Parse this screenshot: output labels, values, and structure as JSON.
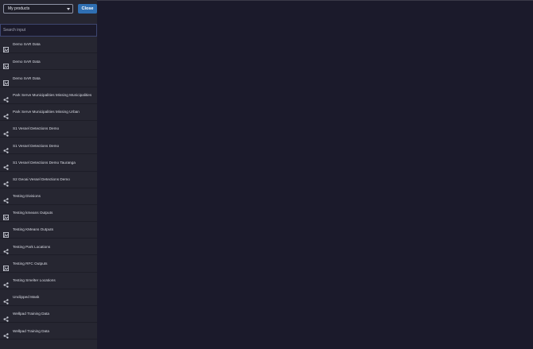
{
  "header": {
    "dropdown_value": "My products",
    "close_label": "Close"
  },
  "search": {
    "placeholder": "Search input"
  },
  "products": [
    {
      "label": "Demo SAR Data",
      "icon": "image-icon"
    },
    {
      "label": "Demo SAR Data",
      "icon": "image-icon"
    },
    {
      "label": "Demo SAR Data",
      "icon": "image-icon"
    },
    {
      "label": "Park Serve Municipalities Missing Municipalities",
      "icon": "share-icon"
    },
    {
      "label": "Park Serve Municipalities Missing Urban",
      "icon": "share-icon"
    },
    {
      "label": "S1 Vessel Detections Demo",
      "icon": "share-icon"
    },
    {
      "label": "S1 Vessel Detections Demo",
      "icon": "share-icon"
    },
    {
      "label": "S1 Vessel Detections Demo Tauranga",
      "icon": "share-icon"
    },
    {
      "label": "S2 Geoai Vessel Detections Demo",
      "icon": "share-icon"
    },
    {
      "label": "Testing Divisions",
      "icon": "share-icon"
    },
    {
      "label": "Testing kmeans Outputs",
      "icon": "image-icon"
    },
    {
      "label": "Testing KMeans Outputs",
      "icon": "image-icon"
    },
    {
      "label": "Testing Park Locations",
      "icon": "share-icon"
    },
    {
      "label": "Testing RFC Outputs",
      "icon": "image-icon"
    },
    {
      "label": "Testing Smelter Locations",
      "icon": "share-icon"
    },
    {
      "label": "Unclipped Mask",
      "icon": "share-icon"
    },
    {
      "label": "Wellpad Training Data",
      "icon": "share-icon"
    },
    {
      "label": "Wellpad Training Data",
      "icon": "share-icon"
    }
  ]
}
